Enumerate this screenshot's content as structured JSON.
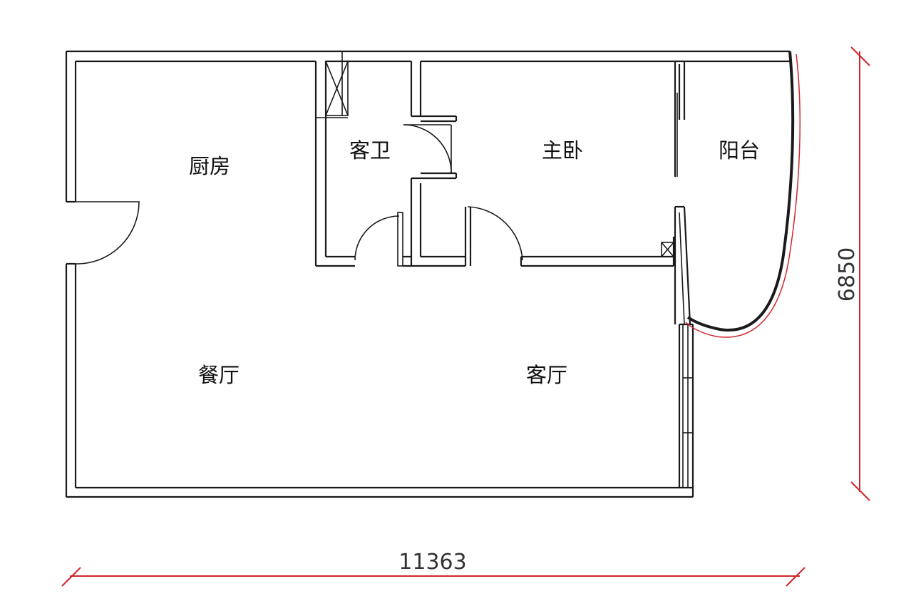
{
  "rooms": {
    "kitchen": "厨房",
    "guest_bath": "客卫",
    "master_bedroom": "主卧",
    "balcony": "阳台",
    "dining_room": "餐厅",
    "living_room": "客厅"
  },
  "dimensions": {
    "width": "11363",
    "height": "6850"
  },
  "colors": {
    "wall": "#1a1a1a",
    "dimension_line": "#d0262c",
    "balcony_outline": "#d0262c"
  }
}
